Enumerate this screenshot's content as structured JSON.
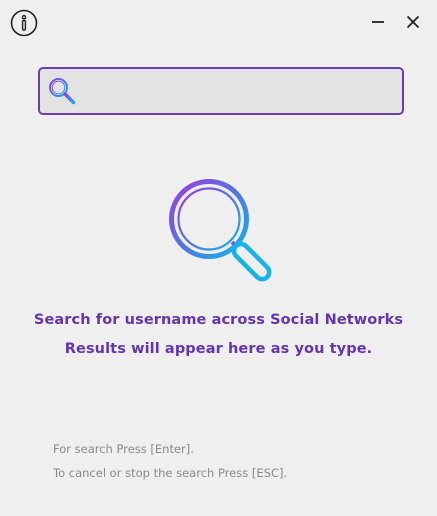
{
  "search": {
    "value": "",
    "placeholder": ""
  },
  "empty_state": {
    "line1": "Search for username across Social Networks",
    "line2": "Results will appear here as you type."
  },
  "hints": {
    "enter": "For search Press [Enter].",
    "escape": "To cancel or stop the search Press [ESC]."
  },
  "icons": {
    "info": "info-icon",
    "minimize": "minimize-icon",
    "close": "close-icon",
    "search": "search-icon",
    "hero": "magnifier-icon"
  },
  "colors": {
    "background": "#efefef",
    "accent_purple": "#6236b0",
    "search_border": "#6a3fb3",
    "gradient_start": "#8e3fe0",
    "gradient_end": "#1fa8e8",
    "hint_text": "#8a8a8a"
  }
}
